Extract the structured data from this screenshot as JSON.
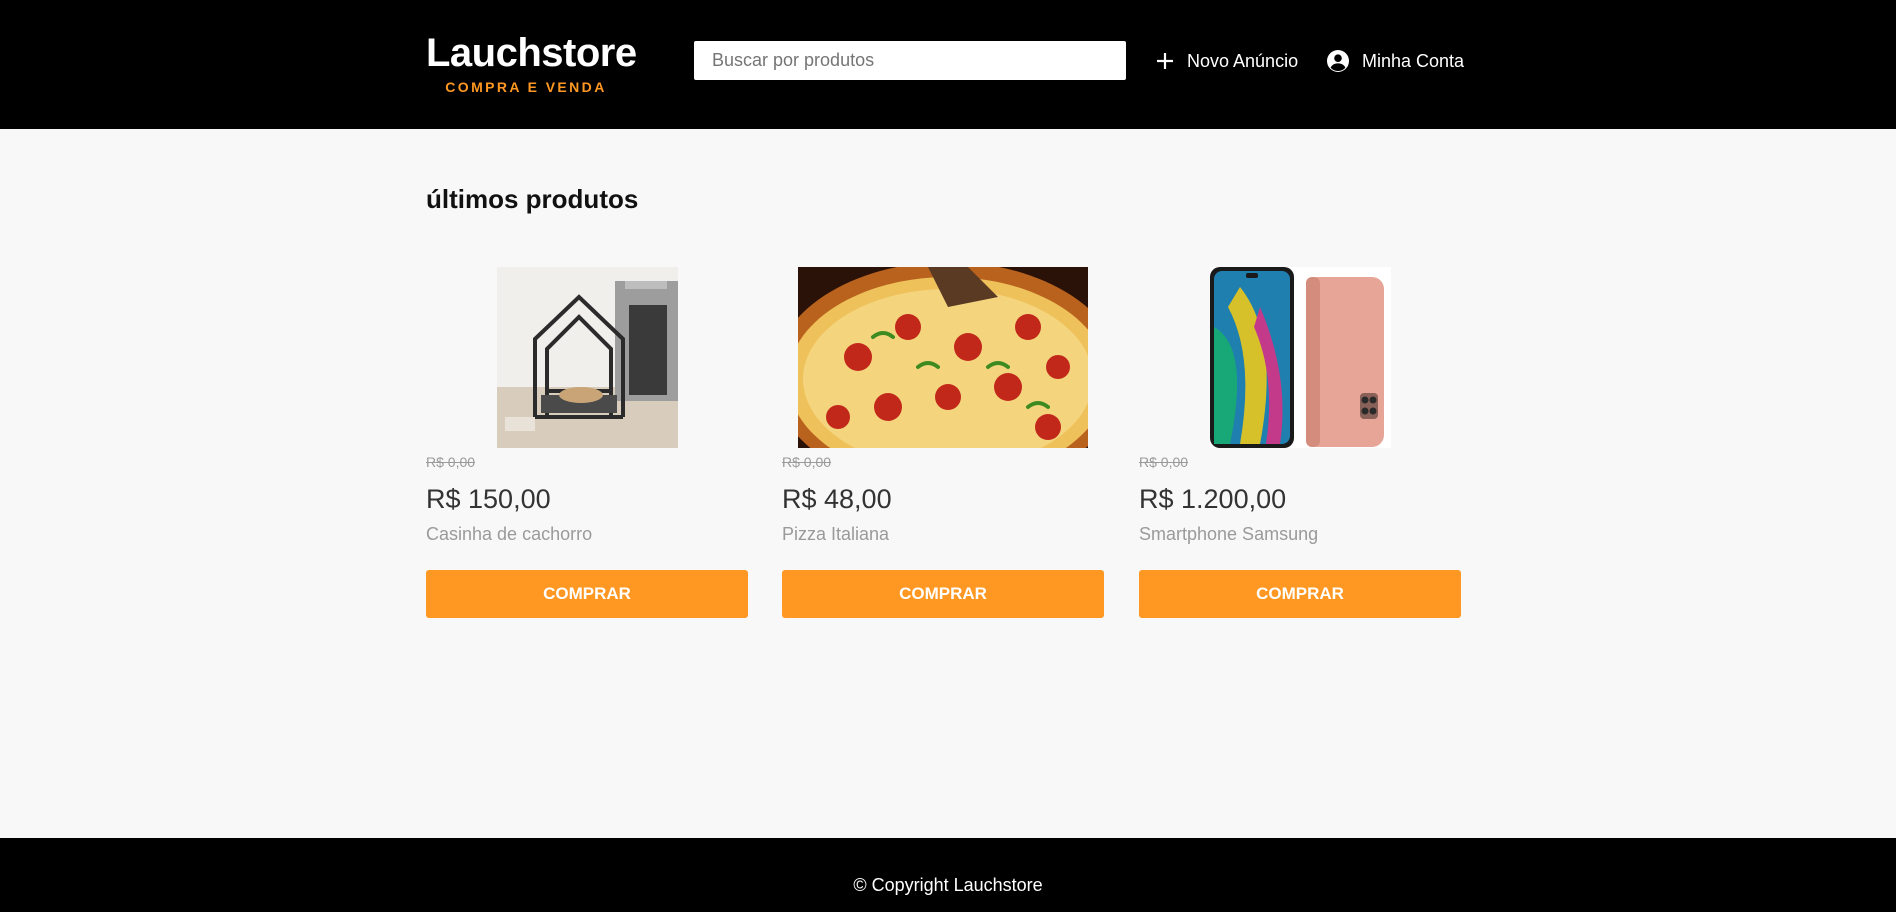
{
  "header": {
    "logo_title": "Lauchstore",
    "logo_subtitle": "COMPRA E VENDA",
    "search_placeholder": "Buscar por produtos",
    "new_ad_label": "Novo Anúncio",
    "account_label": "Minha Conta",
    "new_ad_icon": "plus-icon",
    "account_icon": "user-circle-icon"
  },
  "main": {
    "section_title": "últimos produtos",
    "products": [
      {
        "image": "dog-house-photo",
        "old_price": "R$ 0,00",
        "price": "R$ 150,00",
        "name": "Casinha de cachorro",
        "button_label": "COMPRAR"
      },
      {
        "image": "pizza-photo",
        "old_price": "R$ 0,00",
        "price": "R$ 48,00",
        "name": "Pizza Italiana",
        "button_label": "COMPRAR"
      },
      {
        "image": "smartphone-photo",
        "old_price": "R$ 0,00",
        "price": "R$ 1.200,00",
        "name": "Smartphone Samsung",
        "button_label": "COMPRAR"
      }
    ]
  },
  "footer": {
    "copyright": "© Copyright Lauchstore"
  },
  "colors": {
    "header_bg": "#000000",
    "accent": "#ff9822",
    "page_bg": "#f8f8f8"
  }
}
